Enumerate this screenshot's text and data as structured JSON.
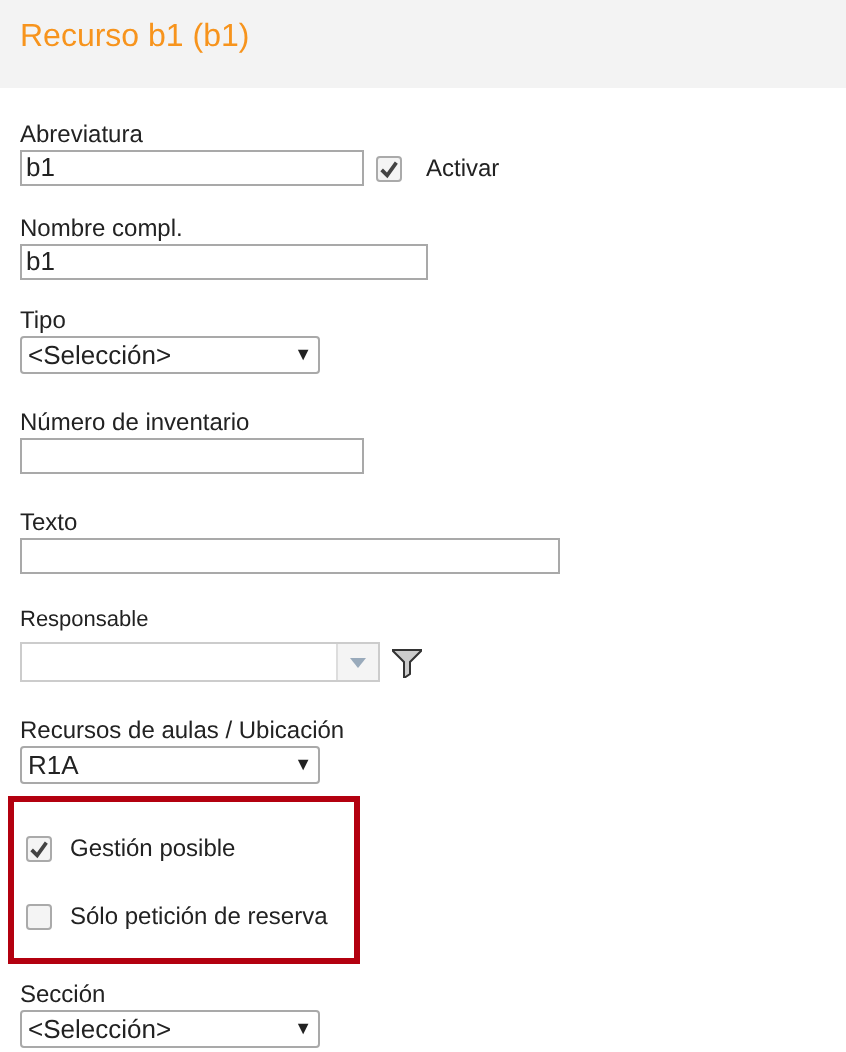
{
  "window": {
    "title": "Recurso b1 (b1)"
  },
  "fields": [
    {
      "kind": "text",
      "label": "Abreviatura",
      "value": "b1",
      "checkbox": {
        "label": "Activar",
        "checked": true
      }
    },
    {
      "kind": "text",
      "label": "Nombre compl.",
      "value": "b1"
    },
    {
      "kind": "select",
      "label": "Tipo",
      "value": "<Selección>",
      "arrow": "▼"
    },
    {
      "kind": "text",
      "label": "Número de inventario"
    },
    {
      "kind": "text",
      "label": "Texto"
    },
    {
      "kind": "combo",
      "label": "Responsable"
    },
    {
      "kind": "select",
      "label": "Recursos de aulas / Ubicación",
      "value": "R1A",
      "arrow": "▼"
    },
    {
      "kind": "checkgroup",
      "options": [
        {
          "label": "Gestión posible",
          "checked": true
        },
        {
          "label": "Sólo petición de reserva",
          "checked": false
        }
      ]
    },
    {
      "kind": "select",
      "label": "Sección",
      "value": "<Selección>",
      "arrow": "▼"
    }
  ]
}
